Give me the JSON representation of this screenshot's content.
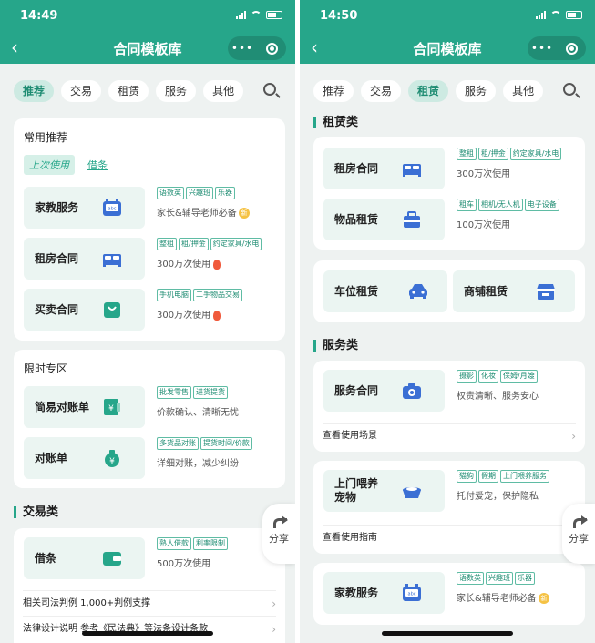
{
  "colors": {
    "brand": "#26a68a",
    "tile": "#ebf5f2",
    "icon": "#3b6fd4"
  },
  "left": {
    "time": "14:49",
    "title": "合同模板库",
    "tabs": [
      "推荐",
      "交易",
      "租赁",
      "服务",
      "其他"
    ],
    "common": {
      "title": "常用推荐",
      "pill_on": "上次使用",
      "pill_off": "借条",
      "items": [
        {
          "name": "家教服务",
          "tags": [
            "语数英",
            "兴趣班",
            "乐器"
          ],
          "desc": "家长&辅导老师必备",
          "mark": "新"
        },
        {
          "name": "租房合同",
          "tags": [
            "整租",
            "租/押金",
            "约定家具/水电"
          ],
          "desc": "300万次使用"
        },
        {
          "name": "买卖合同",
          "tags": [
            "手机电脑",
            "二手物品交易"
          ],
          "desc": "300万次使用"
        }
      ]
    },
    "limited": {
      "title": "限时专区",
      "items": [
        {
          "name": "简易对账单",
          "tags": [
            "批发零售",
            "进货提货"
          ],
          "desc": "价款确认、清晰无忧"
        },
        {
          "name": "对账单",
          "tags": [
            "多货品对账",
            "提货时间/价款"
          ],
          "desc": "详细对账，减少纠纷"
        }
      ]
    },
    "trade": {
      "title": "交易类",
      "item": {
        "name": "借条",
        "tags": [
          "熟人借款",
          "利率限制"
        ],
        "desc": "500万次使用"
      },
      "link1": "相关司法判例 1,000+判例支撑",
      "link2": "法律设计说明 参考《民法典》等法条设计条款"
    },
    "share": "分享"
  },
  "right": {
    "time": "14:50",
    "title": "合同模板库",
    "tabs": [
      "推荐",
      "交易",
      "租赁",
      "服务",
      "其他"
    ],
    "lease": {
      "title": "租赁类",
      "items": [
        {
          "name": "租房合同",
          "tags": [
            "整租",
            "租/押金",
            "约定家具/水电"
          ],
          "desc": "300万次使用"
        },
        {
          "name": "物品租赁",
          "tags": [
            "租车",
            "相机/无人机",
            "电子设备"
          ],
          "desc": "100万次使用"
        }
      ],
      "small": [
        {
          "name": "车位租赁"
        },
        {
          "name": "商铺租赁"
        }
      ]
    },
    "service": {
      "title": "服务类",
      "items": [
        {
          "name": "服务合同",
          "tags": [
            "摄影",
            "化妆",
            "保姆/月嫂"
          ],
          "desc": "权责清晰、服务安心",
          "link": "查看使用场景"
        },
        {
          "name": "上门喂养\n宠物",
          "tags": [
            "猫狗",
            "假期",
            "上门喂养服务"
          ],
          "desc": "托付爱宠，保护隐私",
          "link": "查看使用指南"
        },
        {
          "name": "家教服务",
          "tags": [
            "语数英",
            "兴趣班",
            "乐器"
          ],
          "desc": "家长&辅导老师必备",
          "mark": "新"
        }
      ]
    },
    "share": "分享"
  }
}
